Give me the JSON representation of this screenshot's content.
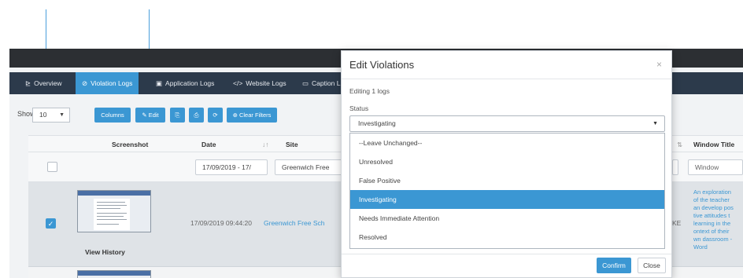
{
  "tabs": [
    {
      "icon": "chart-icon",
      "glyph": "⊵",
      "label": "Overview"
    },
    {
      "icon": "ban-icon",
      "glyph": "⊘",
      "label": "Violation Logs"
    },
    {
      "icon": "window-icon",
      "glyph": "▣",
      "label": "Application Logs"
    },
    {
      "icon": "code-icon",
      "glyph": "</>",
      "label": "Website Logs"
    },
    {
      "icon": "caption-icon",
      "glyph": "▭",
      "label": "Caption L"
    }
  ],
  "toolbar": {
    "show_label": "Show",
    "show_value": "10",
    "columns_label": "Columns",
    "edit_label": "Edit",
    "edit_glyph": "✎",
    "csv_glyph": "⎘",
    "print_glyph": "⎙",
    "refresh_glyph": "⟳",
    "clear_filters_label": "Clear Filters",
    "clear_glyph": "⊕"
  },
  "table": {
    "headers": {
      "screenshot": "Screenshot",
      "date": "Date",
      "date_sort": "↓↑",
      "site": "Site",
      "col_cut": "⇅",
      "window_title": "Window Title"
    },
    "filters": {
      "date": "17/09/2019 - 17/",
      "site": "Greenwich Free",
      "window": "Window"
    },
    "row": {
      "selected": true,
      "date": "17/09/2019 09:44:20",
      "site": "Greenwich Free Sch",
      "cut": "KE",
      "history": "View History",
      "window_title_lines": [
        "An exploration",
        "of the teacher",
        "an develop pos",
        "tive attitudes t",
        "learning in the",
        "ontext of their",
        "wn dassroom -",
        "Word"
      ]
    }
  },
  "modal": {
    "title": "Edit Violations",
    "close_glyph": "×",
    "editing_text": "Editing 1 logs",
    "status_label": "Status",
    "status_value": "Investigating",
    "options": [
      "--Leave Unchanged--",
      "Unresolved",
      "False Positive",
      "Investigating",
      "Needs Immediate Attention",
      "Resolved"
    ],
    "selected_option_index": 3,
    "confirm_label": "Confirm",
    "close_label": "Close"
  },
  "colors": {
    "accent": "#3b97d3",
    "arrow": "#4a9fdc",
    "tabbar": "#2c3a4b"
  }
}
